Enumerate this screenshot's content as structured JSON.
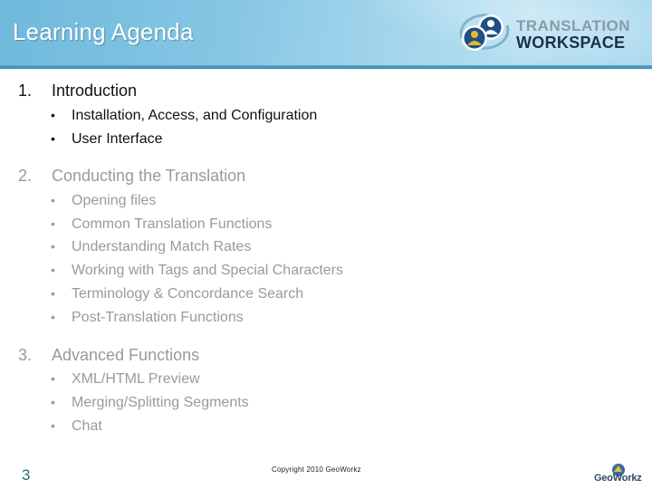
{
  "header": {
    "title": "Learning Agenda",
    "logo": {
      "icon": "two-users-cycle-icon",
      "line1": "TRANSLATION",
      "line2": "WORKSPACE"
    }
  },
  "agenda": {
    "sections": [
      {
        "number": "1.",
        "label": "Introduction",
        "state": "active",
        "bullets": [
          "Installation, Access, and Configuration",
          "User Interface"
        ]
      },
      {
        "number": "2.",
        "label": "Conducting the Translation",
        "state": "dimmed",
        "bullets": [
          "Opening files",
          "Common Translation Functions",
          "Understanding Match Rates",
          "Working with Tags and Special Characters",
          "Terminology & Concordance Search",
          "Post-Translation Functions"
        ]
      },
      {
        "number": "3.",
        "label": "Advanced Functions",
        "state": "dimmed",
        "bullets": [
          "XML/HTML Preview",
          "Merging/Splitting Segments",
          "Chat"
        ]
      }
    ],
    "bullet_glyph": "•"
  },
  "footer": {
    "page_number": "3",
    "copyright": "Copyright 2010 GeoWorkz",
    "brand_logo": "GeoWorkz"
  },
  "colors": {
    "header_blue": "#86c6e4",
    "strip_blue": "#3f86a8",
    "active_text": "#111111",
    "dimmed_text": "#9a9a9a",
    "page_number": "#2f6f7a",
    "logo_dark": "#1d2f4a",
    "logo_grey": "#8a9aa8"
  }
}
